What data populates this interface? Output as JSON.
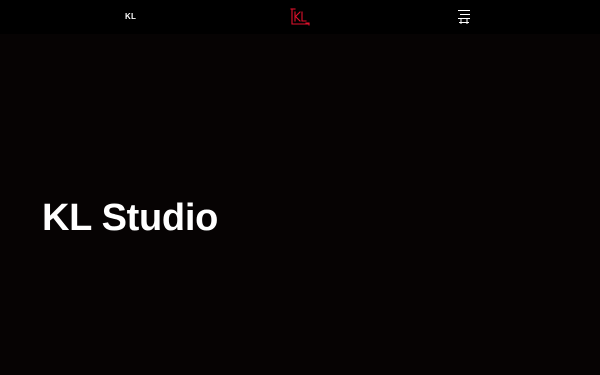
{
  "header": {
    "logo_text": "KL",
    "brand_mark_icon": "kl-monogram-icon",
    "brand_color": "#e0112b",
    "menu_icon": "hamburger-menu-icon"
  },
  "hero": {
    "title": "KL Studio"
  },
  "colors": {
    "background": "#060303",
    "header_background": "#000000",
    "text": "#ffffff",
    "accent": "#e0112b"
  }
}
